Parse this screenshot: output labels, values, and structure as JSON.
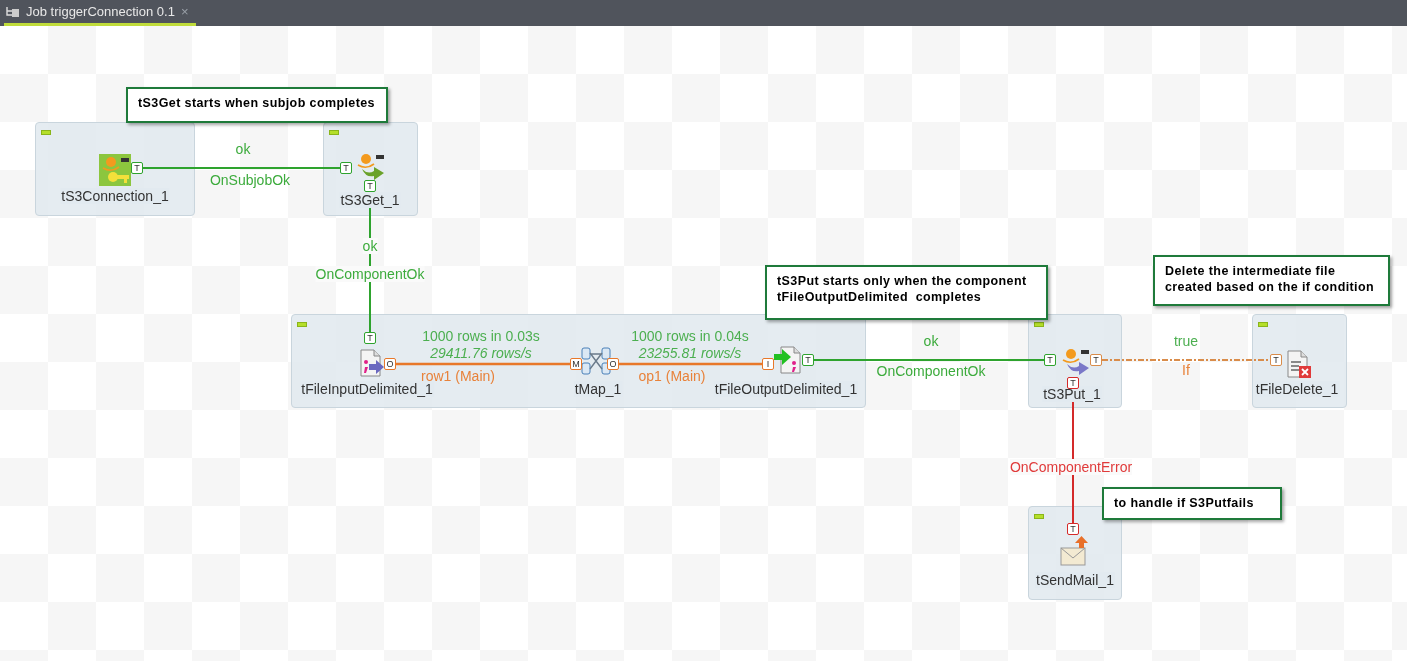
{
  "tab": {
    "title": "Job triggerConnection 0.1",
    "close": "×",
    "selected": true
  },
  "subjobs": [
    {
      "components": [
        {
          "label": "tS3Connection_1",
          "kind": "s3connection"
        }
      ]
    },
    {
      "components": [
        {
          "label": "tS3Get_1",
          "kind": "s3get"
        }
      ]
    },
    {
      "components": [
        {
          "label": "tFileInputDelimited_1",
          "kind": "fileinput"
        },
        {
          "label": "tMap_1",
          "kind": "map"
        },
        {
          "label": "tFileOutputDelimited_1",
          "kind": "fileoutput"
        }
      ]
    },
    {
      "components": [
        {
          "label": "tS3Put_1",
          "kind": "s3put"
        }
      ]
    },
    {
      "components": [
        {
          "label": "tFileDelete_1",
          "kind": "filedelete"
        }
      ]
    },
    {
      "components": [
        {
          "label": "tSendMail_1",
          "kind": "sendmail"
        }
      ]
    }
  ],
  "connections": [
    {
      "kind": "trigger",
      "from_port": "T",
      "to_port": "T",
      "label_above": "ok",
      "label_below": "OnSubjobOk"
    },
    {
      "kind": "trigger",
      "from_port": "T",
      "to_port": "T",
      "label_above": "ok",
      "label_below": "OnComponentOk"
    },
    {
      "kind": "main",
      "from_port": "O",
      "to_port": "M",
      "label_above": "1000 rows in 0.03s",
      "rate": "29411.76 rows/s",
      "label_below": "row1 (Main)"
    },
    {
      "kind": "main",
      "from_port": "O",
      "to_port": "I",
      "label_above": "1000 rows in 0.04s",
      "rate": "23255.81 rows/s",
      "label_below": "op1 (Main)"
    },
    {
      "kind": "trigger",
      "from_port": "T",
      "to_port": "T",
      "label_above": "ok",
      "label_below": "OnComponentOk"
    },
    {
      "kind": "if",
      "from_port": "T",
      "to_port": "T",
      "label_above": "true",
      "label_below": "If"
    },
    {
      "kind": "error",
      "from_port": "T",
      "to_port": "T",
      "label_below": "OnComponentError"
    }
  ],
  "notes": [
    {
      "text": "tS3Get starts when subjob completes"
    },
    {
      "text": "tS3Put starts only when the component\ntFileOutputDelimited  completes"
    },
    {
      "text": "Delete the intermediate file\ncreated based on the if condition"
    },
    {
      "text": "to handle if S3Putfails"
    }
  ]
}
